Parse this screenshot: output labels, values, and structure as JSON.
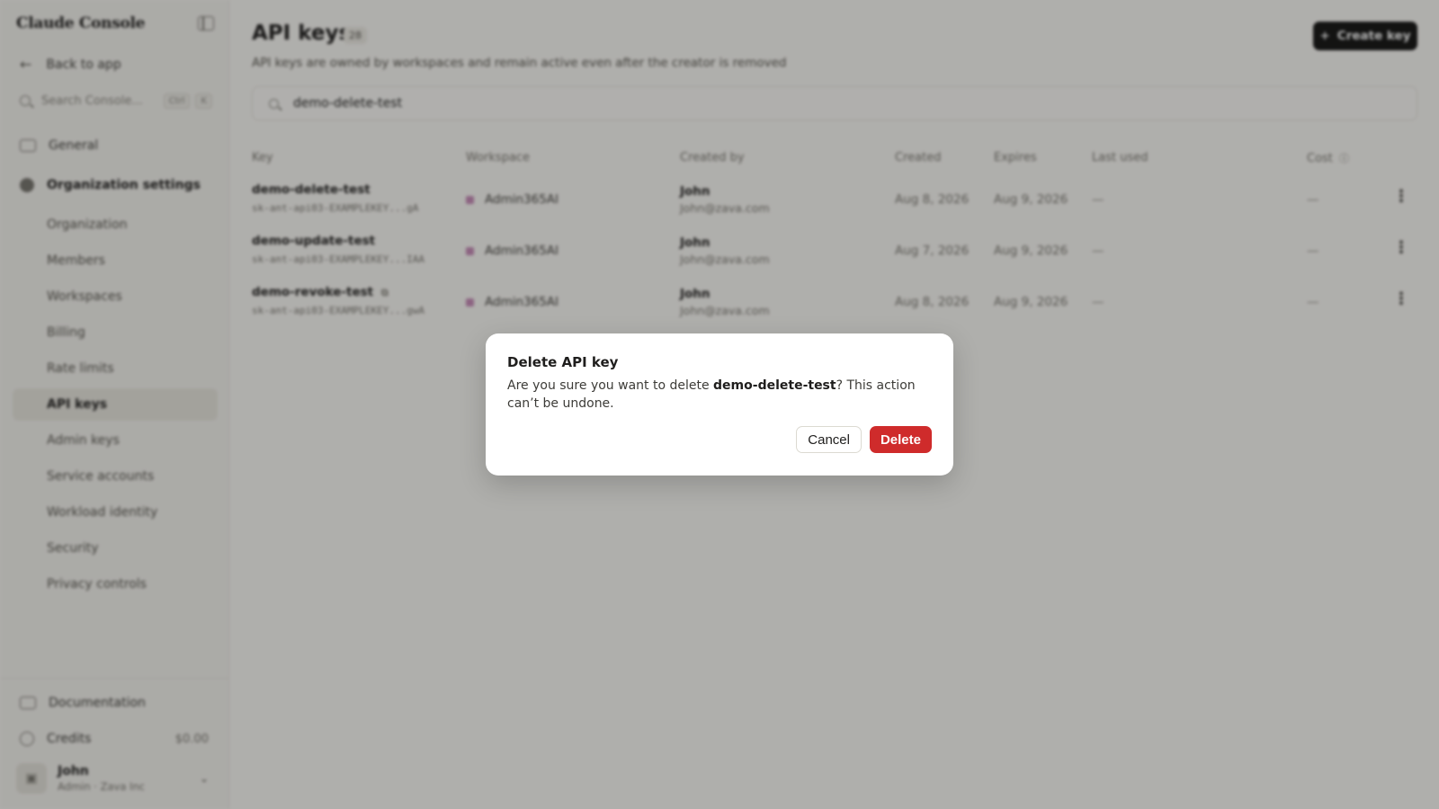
{
  "sidebar": {
    "brand": "Claude Console",
    "back_label": "Back to app",
    "search_placeholder": "Search Console...",
    "search_kbd1": "Ctrl",
    "search_kbd2": "K",
    "general": "General",
    "org_settings": "Organization settings",
    "items": [
      {
        "label": "Organization"
      },
      {
        "label": "Members"
      },
      {
        "label": "Workspaces"
      },
      {
        "label": "Billing"
      },
      {
        "label": "Rate limits"
      },
      {
        "label": "API keys"
      },
      {
        "label": "Admin keys"
      },
      {
        "label": "Service accounts"
      },
      {
        "label": "Workload identity"
      },
      {
        "label": "Security"
      },
      {
        "label": "Privacy controls"
      }
    ],
    "documentation": "Documentation",
    "credits_label": "Credits",
    "credits_value": "$0.00",
    "user_name": "John",
    "user_role": "Admin · Zava Inc"
  },
  "main": {
    "title": "API keys",
    "count": "28",
    "subtitle": "API keys are owned by workspaces and remain active even after the creator is removed",
    "create_label": "Create key",
    "filter_value": "demo-delete-test",
    "columns": {
      "key": "Key",
      "workspace": "Workspace",
      "created_by": "Created by",
      "created": "Created",
      "expires": "Expires",
      "last_used": "Last used",
      "cost": "Cost"
    },
    "rows": [
      {
        "name": "demo-delete-test",
        "secret": "sk-ant-api03-EXAMPLEKEY...gA",
        "workspace": "Admin365AI",
        "creator": "John",
        "email": "John@zava.com",
        "created": "Aug 8, 2026",
        "expires": "Aug 9, 2026",
        "last_used": "—",
        "cost": "—"
      },
      {
        "name": "demo-update-test",
        "secret": "sk-ant-api03-EXAMPLEKEY...IAA",
        "workspace": "Admin365AI",
        "creator": "John",
        "email": "John@zava.com",
        "created": "Aug 7, 2026",
        "expires": "Aug 9, 2026",
        "last_used": "—",
        "cost": "—"
      },
      {
        "name": "demo-revoke-test",
        "secret": "sk-ant-api03-EXAMPLEKEY...gwA",
        "workspace": "Admin365AI",
        "creator": "John",
        "email": "John@zava.com",
        "created": "Aug 8, 2026",
        "expires": "Aug 9, 2026",
        "last_used": "—",
        "cost": "—"
      }
    ]
  },
  "dialog": {
    "title": "Delete API key",
    "body_prefix": "Are you sure you want to delete ",
    "body_key": "demo-delete-test",
    "body_suffix": "? This action can’t be undone.",
    "cancel_label": "Cancel",
    "delete_label": "Delete"
  },
  "colors": {
    "accent_danger": "#cf2b2b",
    "primary_button": "#141413",
    "workspace_dot": "#c68bb7"
  }
}
